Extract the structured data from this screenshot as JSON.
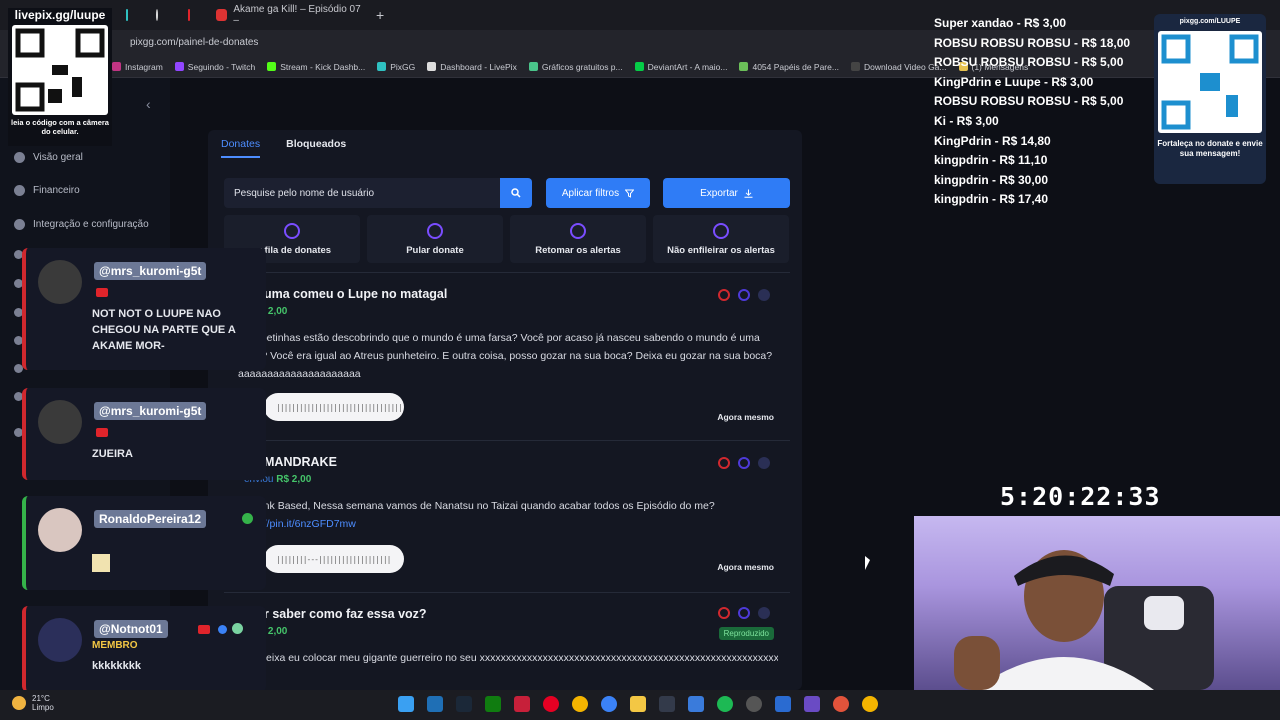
{
  "browser": {
    "tabs": [
      {
        "label": "livepix.gg/luupe"
      },
      {
        "label": "Akame ga Kill! – Episódio 07 –"
      }
    ],
    "url": "pixgg.com/painel-de-donates",
    "bookmarks": [
      {
        "label": "Instagram",
        "color": "#c13584"
      },
      {
        "label": "Seguindo - Twitch",
        "color": "#9146ff"
      },
      {
        "label": "Stream - Kick Dashb...",
        "color": "#53fc18"
      },
      {
        "label": "PixGG",
        "color": "#2fc1c1"
      },
      {
        "label": "Dashboard - LivePix",
        "color": "#dddddd"
      },
      {
        "label": "Gráficos gratuitos p...",
        "color": "#4ac48a"
      },
      {
        "label": "DeviantArt - A maio...",
        "color": "#05cc47"
      },
      {
        "label": "4054 Papéis de Pare...",
        "color": "#6bbf59"
      },
      {
        "label": "Download Video Ga...",
        "color": "#444444"
      },
      {
        "label": "(1) Mensagens",
        "color": "#e6c14f"
      }
    ]
  },
  "sidebar": {
    "items": [
      {
        "label": "Visão geral"
      },
      {
        "label": "Financeiro"
      },
      {
        "label": "Integração e configuração"
      }
    ]
  },
  "tabs": {
    "active": "Donates",
    "other": "Bloqueados"
  },
  "toolbar": {
    "search_placeholder": "Pesquise pelo nome de usuário",
    "filter_label": "Aplicar filtros",
    "export_label": "Exportar"
  },
  "actions": [
    {
      "label": "ar fila de donates"
    },
    {
      "label": "Pular donate"
    },
    {
      "label": "Retomar os alertas"
    },
    {
      "label": "Não enfileirar os alertas"
    }
  ],
  "donates": [
    {
      "title": "uma comeu o Lupe no matagal",
      "amount_prefix": "u",
      "amount": "R$ 2,00",
      "message": "e os betinhas estão descobrindo que o mundo é uma farsa? Você por acaso já nasceu sabendo o mundo é uma farsa? Você era igual ao Atreus punheteiro. E outra coisa, posso gozar na sua boca? Deixa eu gozar na sua boca? aaaaaaaaaaaaaaaaaaaaa",
      "link": "",
      "audio": "|||||||||||||||||||||||||||||||||",
      "time": "Agora mesmo",
      "status": ""
    },
    {
      "title": "MANDRAKE",
      "amount_prefix": "enviou",
      "amount": "R$ 2,00",
      "message": "e o Link Based, Nessa semana vamos de Nanatsu no Taizai quando acabar todos os Episódio do me? ",
      "link": "https://pin.it/6nzGFD7mw",
      "audio": "||||||||---|||||||||||||||||||",
      "time": "Agora mesmo",
      "status": ""
    },
    {
      "title": "r saber como faz essa voz?",
      "amount_prefix": "u",
      "amount": "R$ 2,00",
      "message": "uzin deixa eu colocar meu gigante guerreiro no seu xxxxxxxxxxxxxxxxxxxxxxxxxxxxxxxxxxxxxxxxxxxxxxxxxxxxxxxxxxxxxxxxxxxxxxxxxxxxxxxxxxxx",
      "link": "",
      "audio": "",
      "time": "",
      "status": "Reproduzido"
    }
  ],
  "chat": [
    {
      "user": "@mrs_kuromi-g5t",
      "text": "NOT NOT O LUUPE NAO CHEGOU NA PARTE QUE A AKAME MOR-",
      "platform": "youtube",
      "avatar_color": "#3a3a3a",
      "badge": ""
    },
    {
      "user": "@mrs_kuromi-g5t",
      "text": "ZUEIRA",
      "platform": "youtube",
      "avatar_color": "#3a3a3a",
      "badge": ""
    },
    {
      "user": "RonaldoPereira12",
      "text": "",
      "platform": "kick",
      "avatar_color": "#d9c6c0",
      "badge": ""
    },
    {
      "user": "@Notnot01",
      "text": "kkkkkkkk",
      "platform": "youtube",
      "avatar_color": "#2b2f5a",
      "badge": "MEMBRO"
    }
  ],
  "overlay": {
    "qr_left_title": "livepix.gg/luupe",
    "qr_left_note": "leia o código com a câmera do celular.",
    "donors": [
      "Super xandao - R$ 3,00",
      "ROBSU ROBSU ROBSU - R$ 18,00",
      "ROBSU ROBSU ROBSU - R$ 5,00",
      "KingPdrin e Luupe - R$ 3,00",
      "ROBSU ROBSU ROBSU - R$ 5,00",
      "Ki - R$ 3,00",
      "KingPdrin - R$ 14,80",
      "kingpdrin - R$ 11,10",
      "kingpdrin - R$ 30,00",
      "kingpdrin - R$ 17,40"
    ],
    "qr_right_title": "pixgg.com/LUUPE",
    "qr_right_note": "Fortaleça no donate e envie sua mensagem!",
    "timer": "5:20:22:33"
  },
  "taskbar": {
    "temp": "21°C",
    "condition": "Limpo"
  },
  "colors": {
    "accent": "#2f7cf6",
    "amount": "#45c46a",
    "chat_border": "#d0282e",
    "kick_border": "#35b34a"
  }
}
